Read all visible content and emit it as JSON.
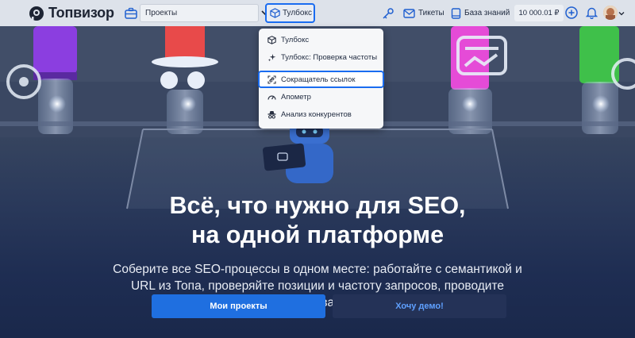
{
  "header": {
    "logo_text": "Топвизор",
    "project_select_value": "Проекты",
    "toolbox_label": "Тулбокс",
    "tickets_label": "Тикеты",
    "knowledge_base_label": "База знаний",
    "balance": "10 000.01 ₽"
  },
  "toolbox_menu": {
    "items": [
      {
        "label": "Тулбокс",
        "icon": "cube-icon"
      },
      {
        "label": "Тулбокс: Проверка частоты",
        "icon": "sparkle-icon"
      },
      {
        "label": "Сокращатель ссылок",
        "icon": "link-shortener-icon"
      },
      {
        "label": "Апометр",
        "icon": "gauge-icon"
      },
      {
        "label": "Анализ конкурентов",
        "icon": "spy-icon"
      }
    ],
    "highlighted_index": 2
  },
  "hero": {
    "headline_line1": "Всё, что нужно для SEO,",
    "headline_line2": "на одной платформе",
    "subtext": "Соберите все SEO-процессы в одном месте: работайте с семантикой и URL из Топа, проверяйте позиции и частоту запросов, проводите технический аудит и отслеживайте изменения на сайтах.",
    "primary_button": "Мои проекты",
    "secondary_button": "Хочу демо!"
  },
  "colors": {
    "accent": "#1a6cf0",
    "primary_button": "#1f6fe0",
    "secondary_button_text": "#5fa0ff",
    "topbar": "#dde2ea"
  }
}
